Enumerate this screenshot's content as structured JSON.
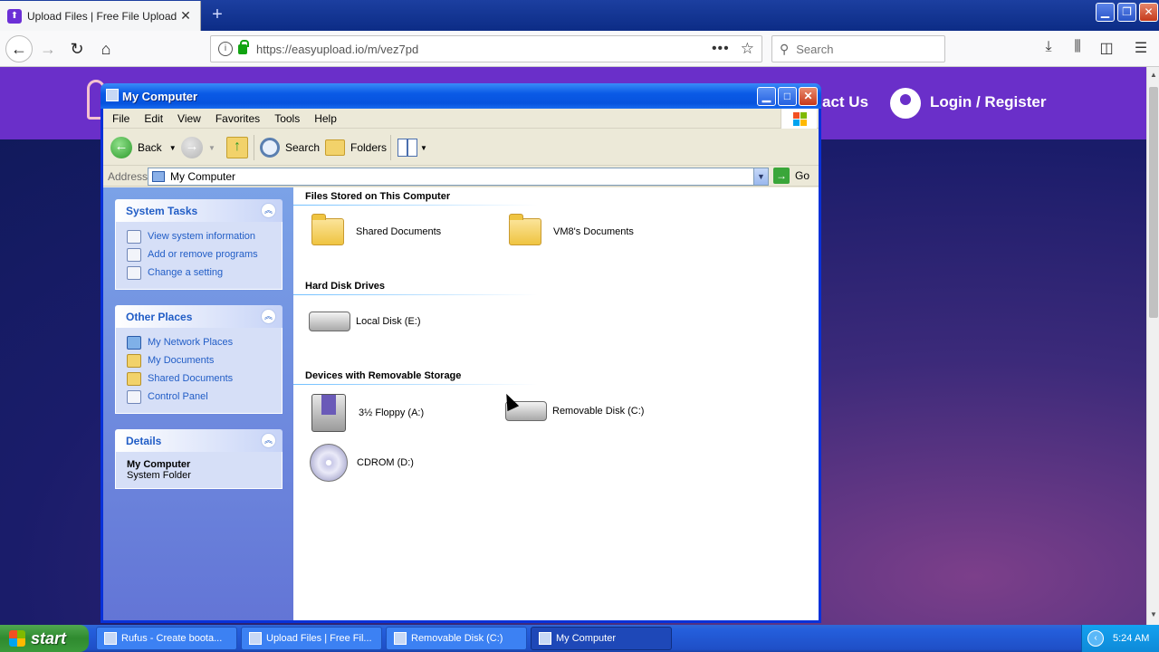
{
  "browser": {
    "tab_title": "Upload Files | Free File Upload and",
    "tab_close": "✕",
    "new_tab": "+",
    "url": "https://easyupload.io/m/vez7pd",
    "search_placeholder": "Search",
    "win_min": "▁",
    "win_restore": "❐",
    "win_close": "✕"
  },
  "website": {
    "contact": "act Us",
    "login": "Login / Register"
  },
  "window": {
    "title": "My Computer",
    "menu": [
      "File",
      "Edit",
      "View",
      "Favorites",
      "Tools",
      "Help"
    ],
    "toolbar": {
      "back": "Back",
      "search": "Search",
      "folders": "Folders"
    },
    "address": {
      "label": "Address",
      "value": "My Computer",
      "go": "Go"
    },
    "left_panels": {
      "system_tasks": {
        "title": "System Tasks",
        "items": [
          "View system information",
          "Add or remove programs",
          "Change a setting"
        ]
      },
      "other_places": {
        "title": "Other Places",
        "items": [
          "My Network Places",
          "My Documents",
          "Shared Documents",
          "Control Panel"
        ]
      },
      "details": {
        "title": "Details",
        "name": "My Computer",
        "sub": "System Folder"
      }
    },
    "groups": {
      "files": {
        "title": "Files Stored on This Computer",
        "items": [
          "Shared Documents",
          "VM8's Documents"
        ]
      },
      "hard_disks": {
        "title": "Hard Disk Drives",
        "items": [
          "Local Disk (E:)"
        ]
      },
      "removable": {
        "title": "Devices with Removable Storage",
        "items": [
          "3½ Floppy (A:)",
          "Removable Disk (C:)",
          "CDROM (D:)"
        ]
      }
    }
  },
  "taskbar": {
    "start": "start",
    "buttons": [
      "Rufus - Create boota...",
      "Upload Files | Free Fil...",
      "Removable Disk (C:)",
      "My Computer"
    ],
    "time": "5:24 AM"
  }
}
